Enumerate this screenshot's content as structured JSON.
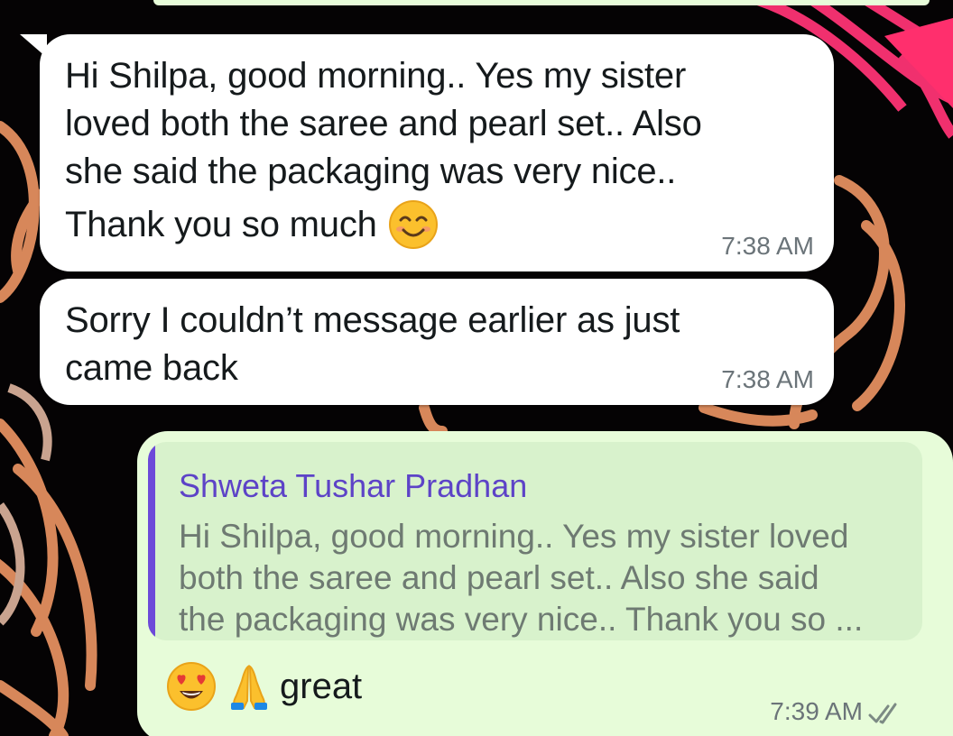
{
  "messages": [
    {
      "direction": "incoming",
      "text_lines": [
        "Hi Shilpa, good morning.. Yes my sister",
        "loved both the saree and pearl set.. Also",
        "she said the packaging was very nice.."
      ],
      "last_line": "Thank you so much",
      "emoji": "smiling-face-icon",
      "time": "7:38 AM"
    },
    {
      "direction": "incoming",
      "text_lines": [
        "Sorry I couldn’t message earlier as just",
        "came back"
      ],
      "time": "7:38 AM"
    },
    {
      "direction": "outgoing",
      "quote": {
        "author": "Shweta Tushar Pradhan",
        "lines": [
          "Hi Shilpa, good morning.. Yes my sister loved",
          "both the saree and pearl set.. Also she said",
          "the packaging was very nice.. Thank you so ..."
        ]
      },
      "emojis": [
        "heart-eyes-icon",
        "folded-hands-icon"
      ],
      "text": "great",
      "time": "7:39 AM",
      "status": "double-check-icon"
    }
  ],
  "colors": {
    "incoming_bubble": "#ffffff",
    "outgoing_bubble": "#e7fcd9",
    "quote_bar": "#6d49d9",
    "quote_author": "#5d43c7",
    "wallpaper": "#050304"
  }
}
